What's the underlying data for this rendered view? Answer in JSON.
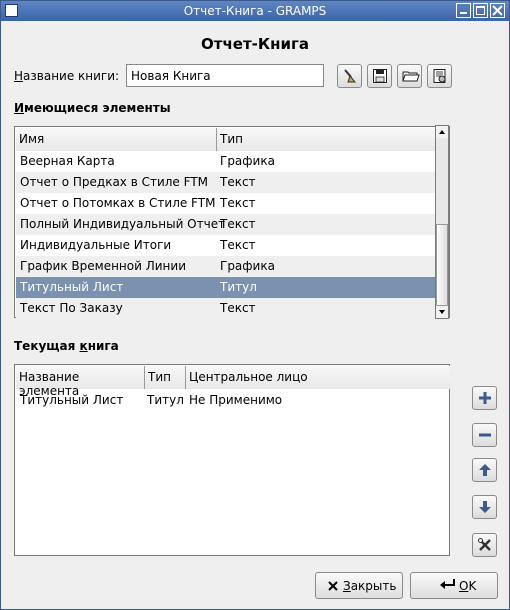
{
  "window": {
    "title": "Отчет-Книга - GRAMPS"
  },
  "heading": "Отчет-Книга",
  "book_name": {
    "label_accel": "Н",
    "label_rest": "азвание книги:",
    "value": "Новая Книга"
  },
  "toolbar_icons": [
    "clear-brush-icon",
    "save-icon",
    "open-folder-icon",
    "edit-books-icon"
  ],
  "available": {
    "label_accel": "И",
    "label_rest": "меющиеся элементы",
    "columns": [
      "Имя",
      "Тип"
    ],
    "rows": [
      {
        "name": "Веерная Карта",
        "type": "Графика"
      },
      {
        "name": "Отчет о Предках в Стиле FTM",
        "type": "Текст"
      },
      {
        "name": "Отчет о Потомках в Стиле FTM",
        "type": "Текст"
      },
      {
        "name": "Полный Индивидуальный Отчет",
        "type": "Текст"
      },
      {
        "name": "Индивидуальные Итоги",
        "type": "Текст"
      },
      {
        "name": "График Временной Линии",
        "type": "Графика"
      },
      {
        "name": "Титульный Лист",
        "type": "Титул"
      },
      {
        "name": "Текст По Заказу",
        "type": "Текст"
      }
    ],
    "selected_index": 6
  },
  "current": {
    "label_pre": "Текущая ",
    "label_accel": "к",
    "label_rest": "нига",
    "columns": [
      "Название элемента",
      "Тип",
      "Центральное лицо"
    ],
    "rows": [
      {
        "name": "Титульный Лист",
        "type": "Титул",
        "center": "Не Применимо"
      }
    ]
  },
  "side_icons": [
    "add-icon",
    "remove-icon",
    "move-up-icon",
    "move-down-icon",
    "configure-icon"
  ],
  "buttons": {
    "close_accel": "З",
    "close_rest": "акрыть",
    "ok_accel": "O",
    "ok_rest": "K"
  },
  "colors": {
    "titlebar": "#4a72b4",
    "selection": "#7a91b0"
  }
}
